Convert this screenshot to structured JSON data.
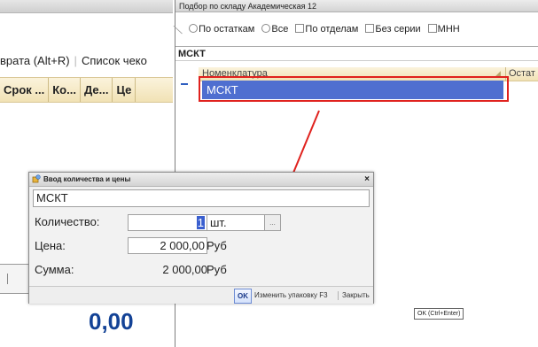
{
  "left_window": {
    "toolbar": {
      "return_label": "врата (Alt+R)",
      "checks_label": "Список чеко"
    },
    "columns": [
      "Срок ...",
      "Ко...",
      "Де...",
      "Це"
    ],
    "slash_text": "/",
    "total": "0,00"
  },
  "selection_window": {
    "title": "Подбор по складу Академическая 12",
    "filters": {
      "by_stock": "По остаткам",
      "all": "Все",
      "by_departments": "По отделам",
      "no_series": "Без серии",
      "mnn": "МНН"
    },
    "search_value": "МСКТ",
    "grid": {
      "col_nomenclature": "Номенклатура",
      "col_stock": "Остат",
      "selected_row": "МСКТ"
    },
    "tooltip": "OK (Ctrl+Enter)"
  },
  "dialog": {
    "title": "Ввод количества и цены",
    "close_glyph": "×",
    "item_name": "МСКТ",
    "quantity_label": "Количество:",
    "quantity_value": "1",
    "quantity_unit": "шт.",
    "unit_dropdown_glyph": "...",
    "price_label": "Цена:",
    "price_value": "2 000,00",
    "price_currency": "Руб",
    "sum_label": "Сумма:",
    "sum_value": "2 000,00",
    "sum_currency": "Руб",
    "buttons": {
      "ok": "OK",
      "change_package": "Изменить упаковку F3",
      "close": "Закрыть"
    }
  },
  "colors": {
    "selection_blue": "#4f6fd0",
    "annotation_red": "#e0221e",
    "total_blue": "#134296"
  }
}
